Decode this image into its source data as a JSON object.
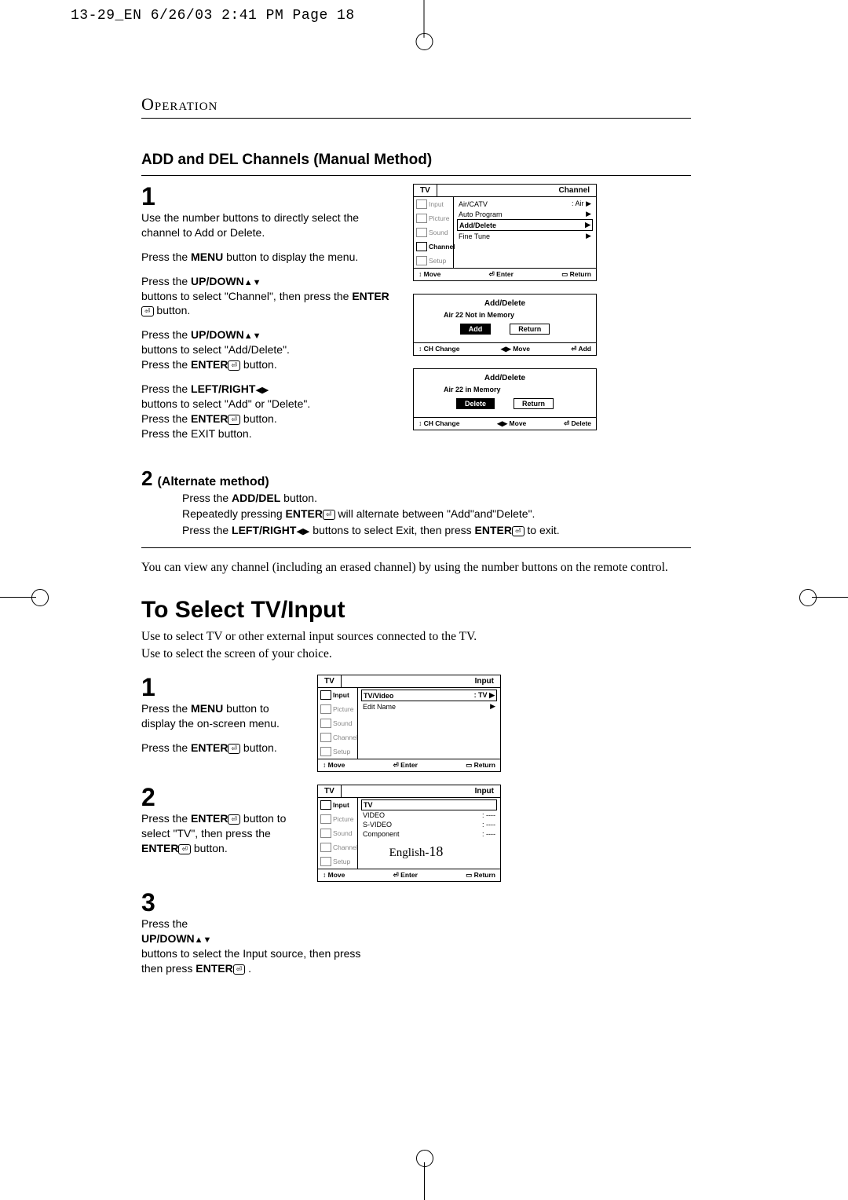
{
  "header": "13-29_EN  6/26/03 2:41 PM  Page 18",
  "op_title": "Operation",
  "section1_title": "ADD and DEL Channels (Manual Method)",
  "step1": {
    "num": "1",
    "p1a": "Use the number buttons to directly select the channel to Add or Delete.",
    "p2a": "Press the ",
    "p2b": "MENU",
    "p2c": " button to display the menu.",
    "p3a": "Press the ",
    "p3b": "UP/DOWN",
    "p3c": " buttons to select \"Channel\", then press the ",
    "p3d": "ENTER",
    "p3e": " button.",
    "p4a": "Press the ",
    "p4b": "UP/DOWN",
    "p4c": " buttons to select \"Add/Delete\".",
    "p5a": "Press the ",
    "p5b": "ENTER",
    "p5c": " button.",
    "p6a": "Press the ",
    "p6b": "LEFT/RIGHT",
    "p6c": " buttons to select \"Add\" or \"Delete\".",
    "p7a": "Press the ",
    "p7b": "ENTER",
    "p7c": " button.",
    "p8": "Press the EXIT button."
  },
  "osd1": {
    "tv": "TV",
    "title": "Channel",
    "side": [
      "Input",
      "Picture",
      "Sound",
      "Channel",
      "Setup"
    ],
    "rows": [
      {
        "l": "Air/CATV",
        "r": ": Air",
        "arrow": true
      },
      {
        "l": "Auto Program",
        "r": "",
        "arrow": true
      },
      {
        "l": "Add/Delete",
        "r": "",
        "arrow": true,
        "boxed": true
      },
      {
        "l": "Fine Tune",
        "r": "",
        "arrow": true
      }
    ],
    "foot": [
      "↕ Move",
      "⏎ Enter",
      "▭ Return"
    ]
  },
  "osd2": {
    "title": "Add/Delete",
    "sub": "Air 22    Not in Memory",
    "btns": [
      {
        "t": "Add",
        "hl": true
      },
      {
        "t": "Return"
      }
    ],
    "foot": [
      "↕ CH Change",
      "◀▶ Move",
      "⏎ Add"
    ]
  },
  "osd3": {
    "title": "Add/Delete",
    "sub": "Air 22    in Memory",
    "btns": [
      {
        "t": "Delete",
        "hl": true
      },
      {
        "t": "Return"
      }
    ],
    "foot": [
      "↕ CH Change",
      "◀▶ Move",
      "⏎ Delete"
    ]
  },
  "alt": {
    "num": "2",
    "title": "(Alternate method)",
    "l1a": "Press the ",
    "l1b": "ADD/DEL",
    "l1c": " button.",
    "l2a": "Repeatedly pressing ",
    "l2b": "ENTER",
    "l2c": " will alternate between \"Add\"and\"Delete\".",
    "l3a": "Press the ",
    "l3b": "LEFT/RIGHT",
    "l3c": " buttons to select Exit, then press ",
    "l3d": "ENTER",
    "l3e": " to exit."
  },
  "note": "You can view any channel (including an erased channel) by using the number buttons on the remote control.",
  "section2_title": "To Select TV/Input",
  "section2_intro1": "Use to select TV or other external input sources connected to the TV.",
  "section2_intro2": "Use to select the screen of your choice.",
  "s2_step1": {
    "num": "1",
    "p1a": "Press the ",
    "p1b": "MENU",
    "p1c": " button to display the on-screen menu.",
    "p2a": "Press the ",
    "p2b": "ENTER",
    "p2c": " button."
  },
  "s2_step2": {
    "num": "2",
    "p1a": "Press the ",
    "p1b": "ENTER",
    "p1c": " button to select \"TV\", then press the ",
    "p1d": "ENTER",
    "p1e": " button."
  },
  "s2_step3": {
    "num": "3",
    "p1a": "Press the ",
    "p1b": "UP/DOWN",
    "p1c": " buttons to select the Input source, then press ",
    "p1d": "ENTER",
    "p1e": " ."
  },
  "osd4": {
    "tv": "TV",
    "title": "Input",
    "side": [
      "Input",
      "Picture",
      "Sound",
      "Channel",
      "Setup"
    ],
    "rows": [
      {
        "l": "TV/Video",
        "r": ": TV",
        "arrow": true,
        "boxed": true
      },
      {
        "l": "Edit Name",
        "r": "",
        "arrow": true
      }
    ],
    "foot": [
      "↕ Move",
      "⏎ Enter",
      "▭ Return"
    ]
  },
  "osd5": {
    "tv": "TV",
    "title": "Input",
    "side": [
      "Input",
      "Picture",
      "Sound",
      "Channel",
      "Setup"
    ],
    "rows": [
      {
        "l": "TV",
        "r": "",
        "boxed": true
      },
      {
        "l": "VIDEO",
        "r": ": ----"
      },
      {
        "l": "S-VIDEO",
        "r": ": ----"
      },
      {
        "l": "Component",
        "r": ": ----"
      }
    ],
    "foot": [
      "↕ Move",
      "⏎ Enter",
      "▭ Return"
    ]
  },
  "footer_pg_a": "English-",
  "footer_pg_b": "18"
}
